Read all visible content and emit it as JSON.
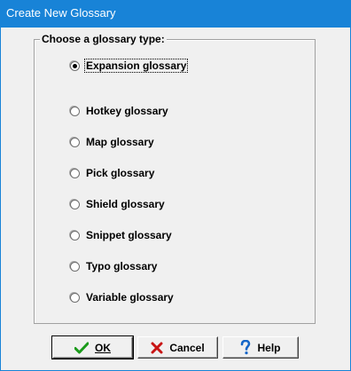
{
  "window": {
    "title": "Create New Glossary"
  },
  "group": {
    "label": "Choose a glossary type:"
  },
  "options": [
    {
      "label": "Expansion glossary",
      "checked": true,
      "focused": true
    },
    {
      "label": "Hotkey glossary",
      "checked": false
    },
    {
      "label": "Map glossary",
      "checked": false
    },
    {
      "label": "Pick glossary",
      "checked": false
    },
    {
      "label": "Shield glossary",
      "checked": false
    },
    {
      "label": "Snippet glossary",
      "checked": false
    },
    {
      "label": "Typo glossary",
      "checked": false
    },
    {
      "label": "Variable glossary",
      "checked": false
    }
  ],
  "buttons": {
    "ok": {
      "label": "OK",
      "icon": "checkmark-icon",
      "color": "#1a9a1a"
    },
    "cancel": {
      "label": "Cancel",
      "icon": "x-icon",
      "color": "#c81414"
    },
    "help": {
      "label": "Help",
      "icon": "question-icon",
      "color": "#1466c8"
    }
  },
  "colors": {
    "titlebar": "#1883d7",
    "dialog_bg": "#f0f0f0"
  }
}
